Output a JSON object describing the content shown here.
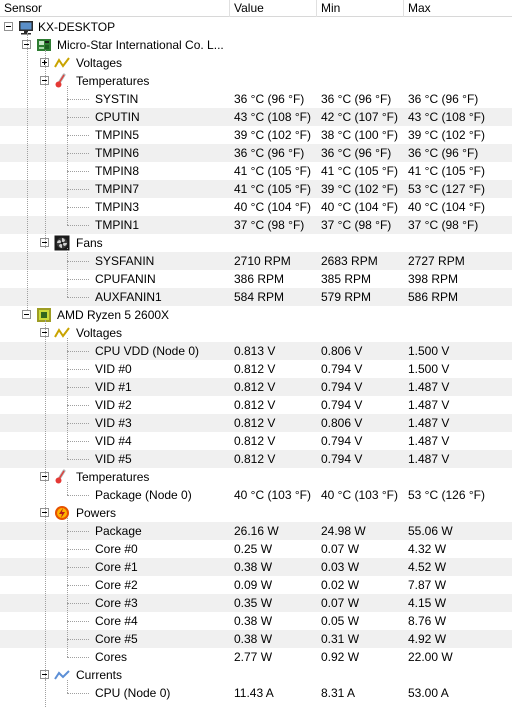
{
  "header": {
    "sensor": "Sensor",
    "value": "Value",
    "min": "Min",
    "max": "Max"
  },
  "tree": {
    "computer": "KX-DESKTOP",
    "board": {
      "name": "Micro-Star International Co. L...",
      "voltages": "Voltages",
      "temperatures": {
        "label": "Temperatures",
        "rows": [
          {
            "name": "SYSTIN",
            "value": "36 °C  (96 °F)",
            "min": "36 °C  (96 °F)",
            "max": "36 °C  (96 °F)"
          },
          {
            "name": "CPUTIN",
            "value": "43 °C  (108 °F)",
            "min": "42 °C  (107 °F)",
            "max": "43 °C  (108 °F)"
          },
          {
            "name": "TMPIN5",
            "value": "39 °C  (102 °F)",
            "min": "38 °C  (100 °F)",
            "max": "39 °C  (102 °F)"
          },
          {
            "name": "TMPIN6",
            "value": "36 °C  (96 °F)",
            "min": "36 °C  (96 °F)",
            "max": "36 °C  (96 °F)"
          },
          {
            "name": "TMPIN8",
            "value": "41 °C  (105 °F)",
            "min": "41 °C  (105 °F)",
            "max": "41 °C  (105 °F)"
          },
          {
            "name": "TMPIN7",
            "value": "41 °C  (105 °F)",
            "min": "39 °C  (102 °F)",
            "max": "53 °C  (127 °F)"
          },
          {
            "name": "TMPIN3",
            "value": "40 °C  (104 °F)",
            "min": "40 °C  (104 °F)",
            "max": "40 °C  (104 °F)"
          },
          {
            "name": "TMPIN1",
            "value": "37 °C  (98 °F)",
            "min": "37 °C  (98 °F)",
            "max": "37 °C  (98 °F)"
          }
        ]
      },
      "fans": {
        "label": "Fans",
        "rows": [
          {
            "name": "SYSFANIN",
            "value": "2710 RPM",
            "min": "2683 RPM",
            "max": "2727 RPM"
          },
          {
            "name": "CPUFANIN",
            "value": "386 RPM",
            "min": "385 RPM",
            "max": "398 RPM"
          },
          {
            "name": "AUXFANIN1",
            "value": "584 RPM",
            "min": "579 RPM",
            "max": "586 RPM"
          }
        ]
      }
    },
    "cpu": {
      "name": "AMD Ryzen 5 2600X",
      "voltages": {
        "label": "Voltages",
        "rows": [
          {
            "name": "CPU VDD (Node 0)",
            "value": "0.813 V",
            "min": "0.806 V",
            "max": "1.500 V"
          },
          {
            "name": "VID #0",
            "value": "0.812 V",
            "min": "0.794 V",
            "max": "1.500 V"
          },
          {
            "name": "VID #1",
            "value": "0.812 V",
            "min": "0.794 V",
            "max": "1.487 V"
          },
          {
            "name": "VID #2",
            "value": "0.812 V",
            "min": "0.794 V",
            "max": "1.487 V"
          },
          {
            "name": "VID #3",
            "value": "0.812 V",
            "min": "0.806 V",
            "max": "1.487 V"
          },
          {
            "name": "VID #4",
            "value": "0.812 V",
            "min": "0.794 V",
            "max": "1.487 V"
          },
          {
            "name": "VID #5",
            "value": "0.812 V",
            "min": "0.794 V",
            "max": "1.487 V"
          }
        ]
      },
      "temperatures": {
        "label": "Temperatures",
        "rows": [
          {
            "name": "Package (Node 0)",
            "value": "40 °C  (103 °F)",
            "min": "40 °C  (103 °F)",
            "max": "53 °C  (126 °F)"
          }
        ]
      },
      "powers": {
        "label": "Powers",
        "rows": [
          {
            "name": "Package",
            "value": "26.16 W",
            "min": "24.98 W",
            "max": "55.06 W"
          },
          {
            "name": "Core #0",
            "value": "0.25 W",
            "min": "0.07 W",
            "max": "4.32 W"
          },
          {
            "name": "Core #1",
            "value": "0.38 W",
            "min": "0.03 W",
            "max": "4.52 W"
          },
          {
            "name": "Core #2",
            "value": "0.09 W",
            "min": "0.02 W",
            "max": "7.87 W"
          },
          {
            "name": "Core #3",
            "value": "0.35 W",
            "min": "0.07 W",
            "max": "4.15 W"
          },
          {
            "name": "Core #4",
            "value": "0.38 W",
            "min": "0.05 W",
            "max": "8.76 W"
          },
          {
            "name": "Core #5",
            "value": "0.38 W",
            "min": "0.31 W",
            "max": "4.92 W"
          },
          {
            "name": "Cores",
            "value": "2.77 W",
            "min": "0.92 W",
            "max": "22.00 W"
          }
        ]
      },
      "currents": {
        "label": "Currents",
        "rows": [
          {
            "name": "CPU (Node 0)",
            "value": "11.43 A",
            "min": "8.31 A",
            "max": "53.00 A"
          }
        ]
      }
    }
  }
}
